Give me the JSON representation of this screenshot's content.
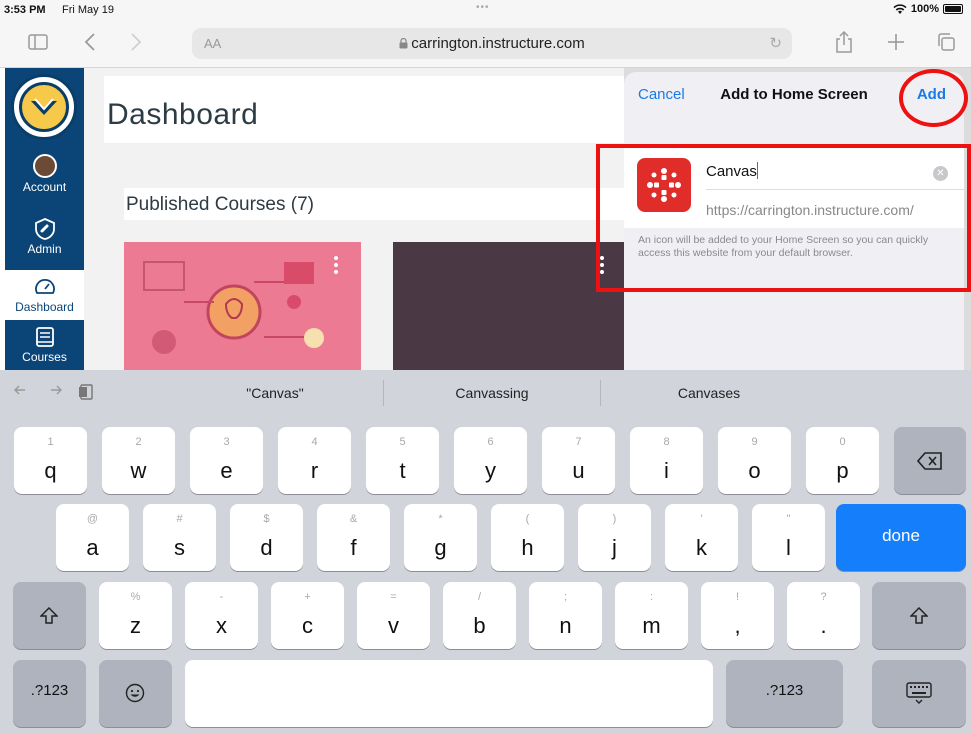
{
  "status_bar": {
    "time": "3:53 PM",
    "date": "Fri May 19",
    "battery": "100%"
  },
  "browser": {
    "text_size_label": "AA",
    "url": "carrington.instructure.com"
  },
  "sidebar": {
    "logo_alt": "CARRINGTON COLLEGE",
    "items": [
      {
        "label": "Account",
        "icon": "avatar"
      },
      {
        "label": "Admin",
        "icon": "shield-icon"
      },
      {
        "label": "Dashboard",
        "icon": "speedometer-icon"
      },
      {
        "label": "Courses",
        "icon": "book-icon"
      }
    ]
  },
  "main": {
    "title": "Dashboard",
    "section": "Published Courses (7)"
  },
  "popover": {
    "cancel": "Cancel",
    "title": "Add to Home Screen",
    "add": "Add",
    "name_value": "Canvas",
    "url_value": "https://carrington.instructure.com/",
    "note": "An icon will be added to your Home Screen so you can quickly access this website from your default browser."
  },
  "keyboard": {
    "suggestions": [
      "\"Canvas\"",
      "Canvassing",
      "Canvases"
    ],
    "row1": [
      {
        "hint": "1",
        "ch": "q"
      },
      {
        "hint": "2",
        "ch": "w"
      },
      {
        "hint": "3",
        "ch": "e"
      },
      {
        "hint": "4",
        "ch": "r"
      },
      {
        "hint": "5",
        "ch": "t"
      },
      {
        "hint": "6",
        "ch": "y"
      },
      {
        "hint": "7",
        "ch": "u"
      },
      {
        "hint": "8",
        "ch": "i"
      },
      {
        "hint": "9",
        "ch": "o"
      },
      {
        "hint": "0",
        "ch": "p"
      }
    ],
    "row2": [
      {
        "hint": "@",
        "ch": "a"
      },
      {
        "hint": "#",
        "ch": "s"
      },
      {
        "hint": "$",
        "ch": "d"
      },
      {
        "hint": "&",
        "ch": "f"
      },
      {
        "hint": "*",
        "ch": "g"
      },
      {
        "hint": "(",
        "ch": "h"
      },
      {
        "hint": ")",
        "ch": "j"
      },
      {
        "hint": "'",
        "ch": "k"
      },
      {
        "hint": "\"",
        "ch": "l"
      }
    ],
    "row3": [
      {
        "hint": "%",
        "ch": "z"
      },
      {
        "hint": "-",
        "ch": "x"
      },
      {
        "hint": "+",
        "ch": "c"
      },
      {
        "hint": "=",
        "ch": "v"
      },
      {
        "hint": "/",
        "ch": "b"
      },
      {
        "hint": ";",
        "ch": "n"
      },
      {
        "hint": ":",
        "ch": "m"
      },
      {
        "hint": "!",
        "ch": ","
      },
      {
        "hint": "?",
        "ch": "."
      }
    ],
    "done": "done",
    "numbers": ".?123"
  }
}
